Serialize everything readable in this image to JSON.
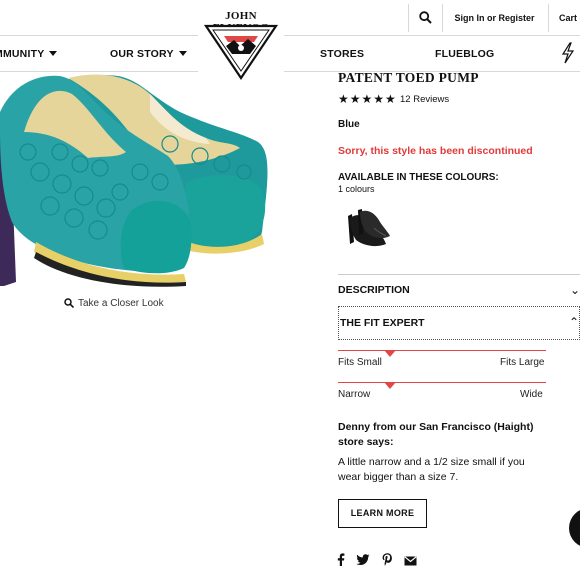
{
  "header": {
    "logo_text": "JOHN FLUEVOG",
    "sign_in": "Sign In or Register",
    "cart": "Cart (",
    "nav": [
      {
        "label": "MMUNITY",
        "has_dropdown": true
      },
      {
        "label": "OUR STORY",
        "has_dropdown": true
      },
      {
        "label": "STORES",
        "has_dropdown": false
      },
      {
        "label": "FLUEBLOG",
        "has_dropdown": false
      }
    ]
  },
  "gallery": {
    "closer_look": "Take a Closer Look"
  },
  "product": {
    "title": "PATENT TOED PUMP",
    "rating": 5,
    "stars": "★★★★★",
    "reviews": "12 Reviews",
    "color": "Blue",
    "status": "Sorry, this style has been discontinued",
    "status_color": "#e03a3a",
    "available_heading": "AVAILABLE IN THESE COLOURS:",
    "colour_count": "1 colours"
  },
  "accordion": {
    "description": "DESCRIPTION",
    "fit_expert": "THE FIT EXPERT"
  },
  "fit": {
    "length": {
      "left": "Fits Small",
      "right": "Fits Large",
      "position": 0.25
    },
    "width": {
      "left": "Narrow",
      "right": "Wide",
      "position": 0.25
    },
    "expert": "Denny from our San Francisco (Haight) store says:",
    "advice": "A little narrow and a 1/2 size small if you wear bigger than a size 7.",
    "learn_more": "LEARN MORE"
  },
  "social": [
    "facebook-icon",
    "twitter-icon",
    "pinterest-icon",
    "email-icon"
  ],
  "accent": "#e04848"
}
